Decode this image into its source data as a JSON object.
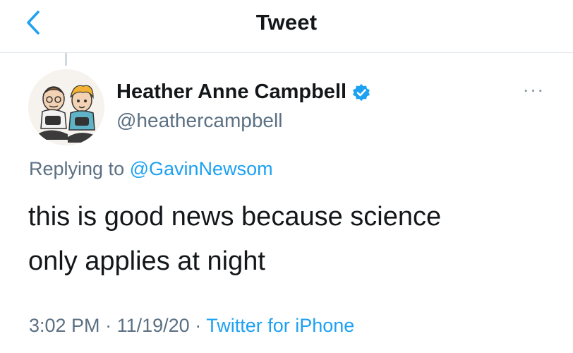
{
  "nav": {
    "title": "Tweet",
    "back_icon": "chevron-left-icon"
  },
  "author": {
    "name": "Heather Anne Campbell",
    "handle": "@heathercampbell",
    "verified": true,
    "avatar_desc": "avatar-illustration"
  },
  "reply": {
    "prefix": "Replying to",
    "mention": "@GavinNewsom"
  },
  "tweet": {
    "text_line1": "this is good news because science",
    "text_line2": "only applies at night"
  },
  "meta": {
    "time": "3:02 PM",
    "date": "11/19/20",
    "separator": "·",
    "source": "Twitter for iPhone"
  },
  "colors": {
    "accent": "#1da1f2",
    "secondary_text": "#5b7083",
    "primary_text": "#14171a"
  }
}
